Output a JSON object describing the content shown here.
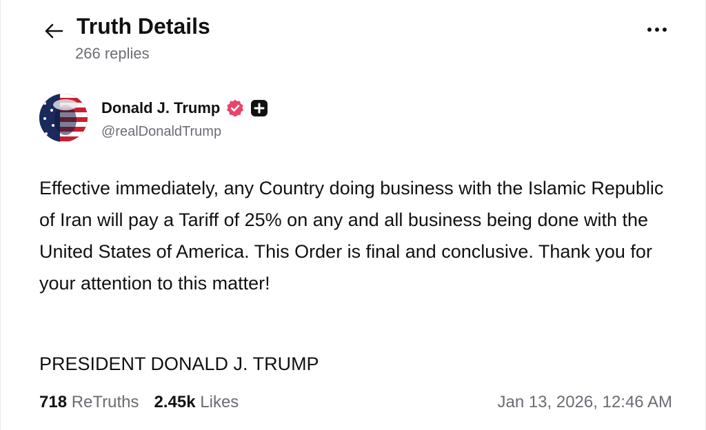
{
  "header": {
    "title": "Truth Details",
    "replies_label": "266 replies",
    "back_icon": "arrow-left-icon",
    "more_icon": "more-horizontal-icon"
  },
  "author": {
    "name": "Donald J. Trump",
    "handle": "@realDonaldTrump",
    "verified_badge_color": "#e8456b",
    "plus_badge_color": "#111111"
  },
  "post": {
    "text": "Effective immediately, any Country doing business with the Islamic Republic of Iran will pay a Tariff of 25% on any and all business being done with the United States of America. This Order is final and conclusive. Thank you for your attention to this matter!",
    "signature": "PRESIDENT DONALD J. TRUMP"
  },
  "stats": {
    "retruths_count": "718",
    "retruths_label": "ReTruths",
    "likes_count": "2.45k",
    "likes_label": "Likes",
    "timestamp": "Jan 13, 2026, 12:46 AM"
  }
}
